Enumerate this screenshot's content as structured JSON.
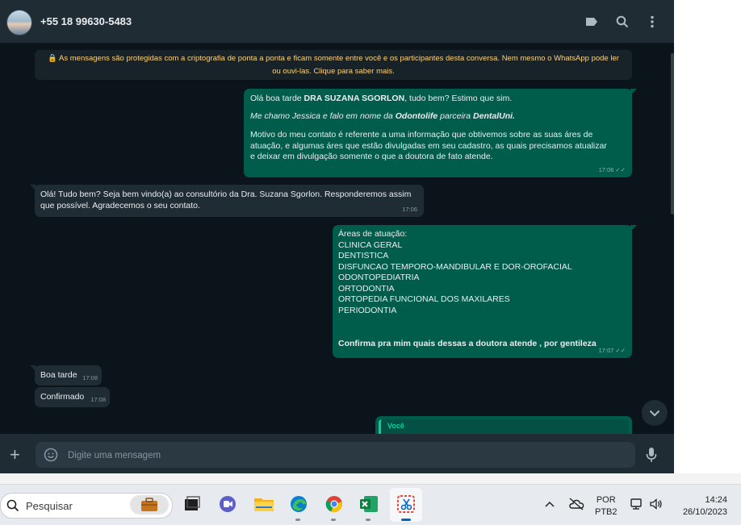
{
  "header": {
    "contact_name": "+55 18 99630-5483",
    "icons": [
      "label-icon",
      "search-icon",
      "menu-icon"
    ]
  },
  "chat": {
    "encryption_notice": "🔒 As mensagens são protegidas com a criptografia de ponta a ponta e ficam somente entre você e os participantes desta conversa. Nem mesmo o WhatsApp pode ler ou ouvi-las. Clique para saber mais.",
    "msg1": {
      "p1_a": "Olá boa tarde ",
      "p1_b": "DRA SUZANA SGORLON",
      "p1_c": ", tudo bem? Estimo que sim.",
      "p2_a": "Me chamo Jessica e falo em nome da ",
      "p2_b": "Odontolife",
      "p2_c": " parceira ",
      "p2_d": "DentalUni.",
      "p3": "Motivo do meu contato é referente a uma informação que obtivemos sobre as suas áres de atuação, e algumas áres que estão divulgadas em seu cadastro, as quais precisamos atualizar e deixar em divulgação somente o que a doutora de fato atende.",
      "time": "17:06"
    },
    "msg2": {
      "text": "Olá! Tudo bem? Seja bem vindo(a) ao consultório da Dra. Suzana Sgorlon. Responderemos assim que possível. Agradecemos o seu contato.",
      "time": "17:06"
    },
    "msg3": {
      "heading": "Áreas de atuação:",
      "areas": [
        "CLINICA GERAL",
        "DENTISTICA",
        "DISFUNCAO TEMPORO-MANDIBULAR E DOR-OROFACIAL",
        "ODONTOPEDIATRIA",
        "ORTODONTIA",
        "ORTOPEDIA FUNCIONAL DOS MAXILARES",
        "PERIODONTIA"
      ],
      "closing": "Confirma pra mim quais dessas a doutora atende , por gentileza",
      "time": "17:07"
    },
    "msg4": {
      "text": "Boa tarde",
      "time": "17:08"
    },
    "msg5": {
      "text": "Confirmado",
      "time": "17:08"
    },
    "msg6": {
      "quote_author": "Você"
    }
  },
  "composer": {
    "placeholder": "Digite uma mensagem"
  },
  "taskbar": {
    "search_label": "Pesquisar",
    "apps": [
      "briefcase-icon",
      "task-view-icon",
      "teams-icon",
      "file-explorer-icon",
      "edge-icon",
      "chrome-icon",
      "excel-icon",
      "snipping-tool-icon"
    ],
    "lang_line1": "POR",
    "lang_line2": "PTB2",
    "time": "14:24",
    "date": "26/10/2023"
  }
}
